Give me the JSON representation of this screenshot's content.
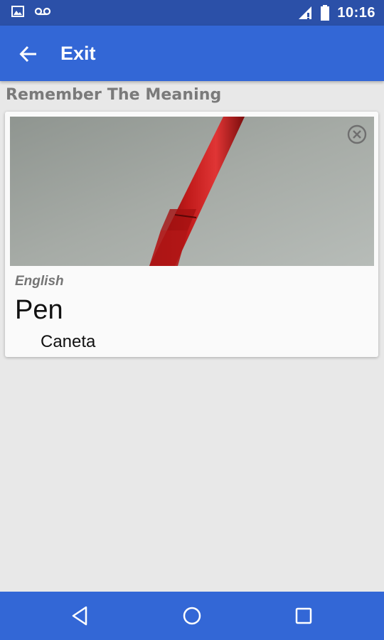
{
  "status_bar": {
    "time": "10:16",
    "icons": [
      "image-notification-icon",
      "voicemail-icon",
      "signal-icon",
      "battery-icon"
    ]
  },
  "app_bar": {
    "back_icon": "arrow-back-icon",
    "title": "Exit"
  },
  "section": {
    "title": "Remember The Meaning"
  },
  "card": {
    "image": "red-pen-photo",
    "close_icon": "close-circle-icon",
    "language": "English",
    "word": "Pen",
    "translation": "Caneta"
  },
  "nav_bar": {
    "buttons": [
      "back-triangle-icon",
      "home-circle-icon",
      "recents-square-icon"
    ]
  },
  "colors": {
    "status_bar": "#2b50a8",
    "app_bar": "#3367d6",
    "background": "#e8e8e8",
    "section_title": "#7a7a7a"
  }
}
